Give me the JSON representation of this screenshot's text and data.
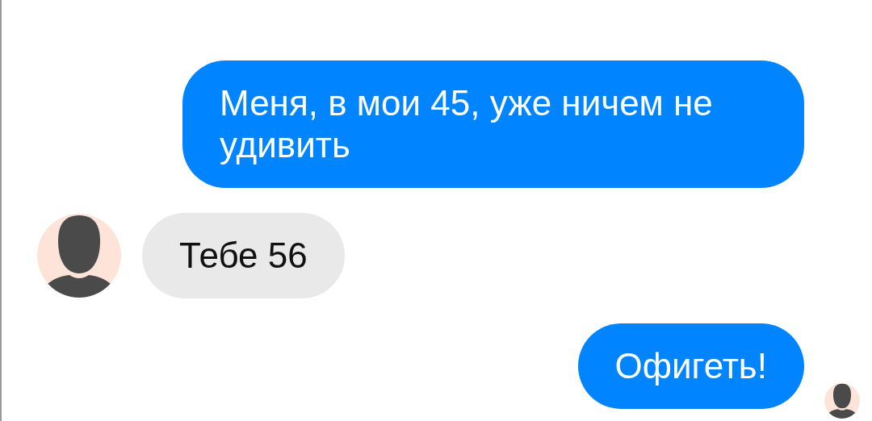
{
  "messages": [
    {
      "kind": "outgoing",
      "text": "Меня, в мои 45, уже ничем не удивить",
      "seen": false
    },
    {
      "kind": "incoming",
      "text": "Тебе 56",
      "seen": false
    },
    {
      "kind": "outgoing",
      "text": "Офигеть!",
      "seen": true
    }
  ]
}
